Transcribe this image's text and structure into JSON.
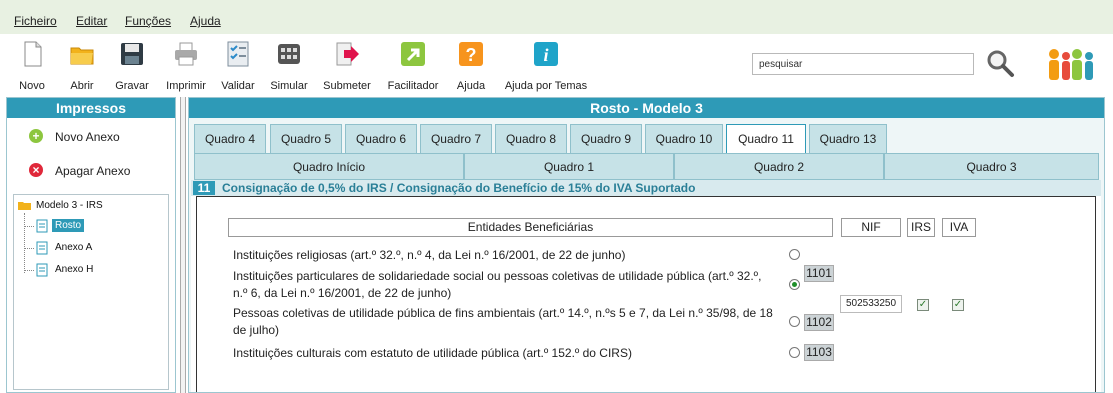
{
  "menu": {
    "items": [
      "Ficheiro",
      "Editar",
      "Funções",
      "Ajuda"
    ]
  },
  "toolbar": {
    "buttons": [
      {
        "label": "Novo",
        "icon": "new-document-icon"
      },
      {
        "label": "Abrir",
        "icon": "open-folder-icon"
      },
      {
        "label": "Gravar",
        "icon": "save-floppy-icon"
      },
      {
        "label": "Imprimir",
        "icon": "printer-icon"
      },
      {
        "label": "Validar",
        "icon": "validate-checklist-icon"
      },
      {
        "label": "Simular",
        "icon": "calculator-icon"
      },
      {
        "label": "Submeter",
        "icon": "submit-arrow-icon"
      },
      {
        "label": "Facilitador",
        "icon": "facilitator-icon"
      },
      {
        "label": "Ajuda",
        "icon": "help-question-icon"
      },
      {
        "label": "Ajuda por Temas",
        "icon": "info-icon"
      }
    ],
    "search_value": "pesquisar"
  },
  "left_panel": {
    "title": "Impressos",
    "actions": [
      "Novo Anexo",
      "Apagar Anexo"
    ],
    "tree": {
      "root": "Modelo 3 - IRS",
      "children": [
        "Rosto",
        "Anexo A",
        "Anexo H"
      ],
      "selected": "Rosto"
    }
  },
  "main": {
    "title": "Rosto - Modelo 3",
    "tabs_row1": [
      "Quadro 4",
      "Quadro 5",
      "Quadro 6",
      "Quadro 7",
      "Quadro 8",
      "Quadro 9",
      "Quadro 10",
      "Quadro 11",
      "Quadro 13"
    ],
    "active_tab": "Quadro 11",
    "tabs_row2": [
      "Quadro Início",
      "Quadro 1",
      "Quadro 2",
      "Quadro 3"
    ],
    "section": {
      "number": "11",
      "title": "Consignação de 0,5% do IRS / Consignação do Benefício de 15% do IVA Suportado",
      "headers": {
        "entidades": "Entidades Beneficiárias",
        "nif": "NIF",
        "irs": "IRS",
        "iva": "IVA"
      },
      "rows": [
        {
          "text": "Instituições religiosas (art.º 32.º, n.º 4, da Lei n.º 16/2001, de 22 de junho)",
          "code": "",
          "selected": false
        },
        {
          "text": "Instituições particulares de solidariedade social ou pessoas coletivas de utilidade pública (art.º 32.º, n.º 6, da Lei n.º 16/2001, de 22 de junho)",
          "code": "1101",
          "selected": true
        },
        {
          "text": "Pessoas coletivas de utilidade pública de fins ambientais (art.º 14.º, n.ºs 5 e 7, da Lei n.º 35/98, de 18 de julho)",
          "code": "1102",
          "selected": false
        },
        {
          "text": "Instituições culturais com estatuto de utilidade pública (art.º 152.º do CIRS)",
          "code": "1103",
          "selected": false
        }
      ],
      "nif_value": "502533250",
      "irs_checked": true,
      "iva_checked": true
    }
  },
  "colors": {
    "accent": "#2e9ab7",
    "tab_bg": "#c6e2e7",
    "menubar_bg": "#e8f1e2"
  }
}
